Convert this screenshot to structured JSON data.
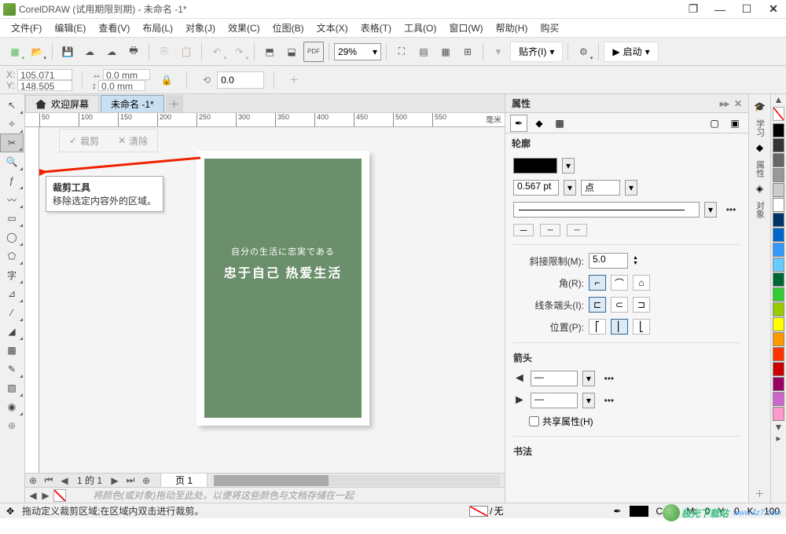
{
  "title": "CorelDRAW (试用期限到期) - 未命名 -1*",
  "menus": [
    "文件(F)",
    "编辑(E)",
    "查看(V)",
    "布局(L)",
    "对象(J)",
    "效果(C)",
    "位图(B)",
    "文本(X)",
    "表格(T)",
    "工具(O)",
    "窗口(W)",
    "帮助(H)",
    "购买"
  ],
  "toolbar1": {
    "zoom": "29%",
    "snap_label": "贴齐(I)",
    "launch_label": "启动"
  },
  "coords": {
    "x": "105.071 mm",
    "y": "148.505 mm"
  },
  "dims": {
    "w": "0.0 mm",
    "h": "0.0 mm"
  },
  "rotate": "0.0",
  "tabs": {
    "home": "欢迎屏幕",
    "doc": "未命名 -1*"
  },
  "crop_actions": {
    "crop": "裁剪",
    "clear": "清除"
  },
  "tooltip": {
    "title": "裁剪工具",
    "desc": "移除选定内容外的区域。"
  },
  "ruler_marks": [
    "50",
    "100",
    "150",
    "200",
    "250",
    "300",
    "350",
    "400",
    "450",
    "500",
    "550"
  ],
  "ruler_unit": "毫米",
  "canvas_text": {
    "line1": "自分の生活に忠実である",
    "line2": "忠于自己 热爱生活"
  },
  "pager": {
    "pg_of": "1 的 1",
    "page_tab": "页 1"
  },
  "swatch_hint": "将颜色(或对象)拖动至此处，以便将这些颜色与文档存储在一起",
  "right_panel": {
    "title": "属性",
    "section": "轮廓",
    "width": "0.567 pt",
    "unit": "点",
    "miter_label": "斜接限制(M):",
    "miter": "5.0",
    "corner_label": "角(R):",
    "caps_label": "线条端头(I):",
    "position_label": "位置(P):",
    "arrow_section": "箭头",
    "share_attrs": "共享属性(H)",
    "calli_section": "书法"
  },
  "dock_labels": [
    "学习",
    "属性",
    "对象"
  ],
  "palette": [
    "#000000",
    "#333333",
    "#666666",
    "#999999",
    "#cccccc",
    "#ffffff",
    "#003366",
    "#0066cc",
    "#3399ff",
    "#66ccff",
    "#006633",
    "#33cc33",
    "#99cc00",
    "#ffff00",
    "#ff9900",
    "#ff3300",
    "#cc0000",
    "#990066",
    "#cc66cc",
    "#ff99cc"
  ],
  "status1": "拖动定义裁剪区域;在区域内双击进行裁剪。",
  "status_fill_label": "无",
  "status_cmyk": {
    "c": "C:",
    "cv": "0",
    "m": "M:",
    "mv": "0",
    "y": "Y:",
    "yv": "0",
    "k": "K:",
    "kv": "100"
  },
  "watermark": "极光下载站",
  "watermark_url": "www.xz7.com"
}
